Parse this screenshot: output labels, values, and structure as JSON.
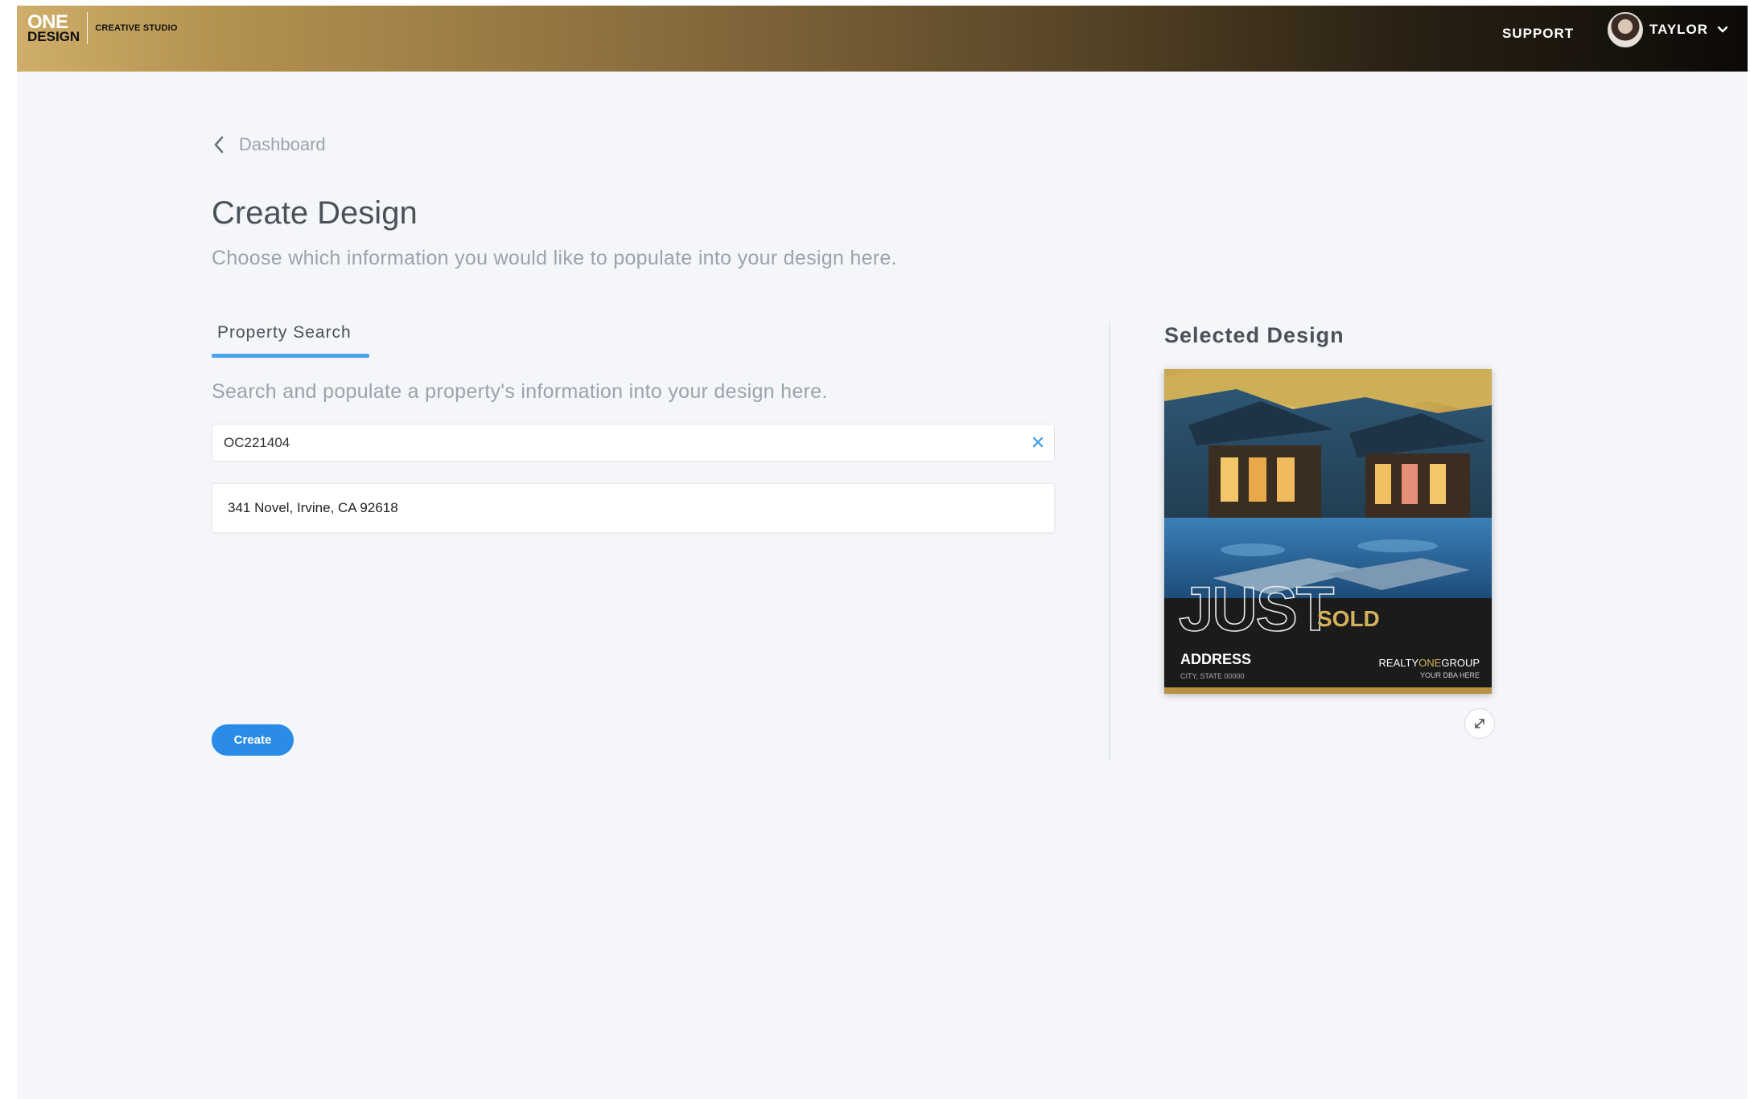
{
  "header": {
    "logo_top": "ONE",
    "logo_bottom": "DESIGN",
    "logo_sub": "CREATIVE STUDIO",
    "support_label": "SUPPORT",
    "user_name": "TAYLOR"
  },
  "breadcrumb": {
    "label": "Dashboard"
  },
  "page": {
    "title": "Create Design",
    "subtitle": "Choose which information you would like to populate into your design here."
  },
  "tabs": [
    {
      "label": "Property Search",
      "active": true
    }
  ],
  "property_search": {
    "description": "Search and populate a property's information into your design here.",
    "query": "OC221404",
    "results": [
      "341 Novel, Irvine, CA 92618"
    ]
  },
  "create_label": "Create",
  "selected_design": {
    "title": "Selected Design",
    "headline_outline": "JUST",
    "headline_accent": "SOLD",
    "address_label": "ADDRESS",
    "address_sub": "CITY, STATE 00000",
    "brand_pre": "REALTY",
    "brand_mid": "ONE",
    "brand_post": "GROUP",
    "brand_sub": "YOUR DBA HERE"
  },
  "colors": {
    "accent": "#2b8ce8",
    "tab_underline": "#4aa3ea",
    "gold": "#d4b25c"
  }
}
